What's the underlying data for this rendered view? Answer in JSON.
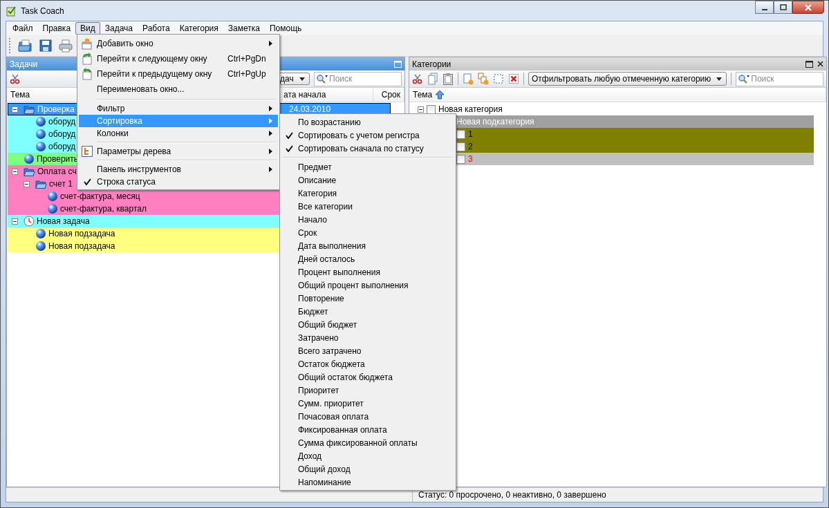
{
  "window": {
    "title": "Task Coach"
  },
  "menubar": [
    {
      "label": "Файл",
      "selected": false
    },
    {
      "label": "Правка",
      "selected": false
    },
    {
      "label": "Вид",
      "selected": true
    },
    {
      "label": "Задача",
      "selected": false
    },
    {
      "label": "Работа",
      "selected": false
    },
    {
      "label": "Категория",
      "selected": false
    },
    {
      "label": "Заметка",
      "selected": false
    },
    {
      "label": "Помощь",
      "selected": false
    }
  ],
  "view_menu": [
    {
      "kind": "item",
      "label": "Добавить окно",
      "submenu": true,
      "selected": false,
      "checked": false
    },
    {
      "kind": "item",
      "label": "Перейти к следующему окну",
      "shortcut": "Ctrl+PgDn",
      "submenu": false,
      "selected": false,
      "checked": false
    },
    {
      "kind": "item",
      "label": "Перейти к предыдущему окну",
      "shortcut": "Ctrl+PgUp",
      "submenu": false,
      "selected": false,
      "checked": false
    },
    {
      "kind": "item",
      "label": "Переименовать окно...",
      "submenu": false,
      "selected": false,
      "checked": false
    },
    {
      "kind": "separator"
    },
    {
      "kind": "item",
      "label": "Фильтр",
      "submenu": true,
      "selected": false,
      "checked": false
    },
    {
      "kind": "item",
      "label": "Сортировка",
      "submenu": true,
      "selected": true,
      "checked": false
    },
    {
      "kind": "item",
      "label": "Колонки",
      "submenu": true,
      "selected": false,
      "checked": false
    },
    {
      "kind": "separator"
    },
    {
      "kind": "item",
      "label": "Параметры дерева",
      "submenu": true,
      "selected": false,
      "checked": false
    },
    {
      "kind": "separator"
    },
    {
      "kind": "item",
      "label": "Панель инструментов",
      "submenu": true,
      "selected": false,
      "checked": false
    },
    {
      "kind": "item",
      "label": "Строка статуса",
      "submenu": false,
      "selected": false,
      "checked": true
    }
  ],
  "sort_menu": [
    {
      "kind": "item",
      "label": "По возрастанию",
      "checked": false
    },
    {
      "kind": "item",
      "label": "Сортировать с учетом регистра",
      "checked": true
    },
    {
      "kind": "item",
      "label": "Сортировать сначала по статусу",
      "checked": true
    },
    {
      "kind": "separator"
    },
    {
      "kind": "item",
      "label": "Предмет",
      "checked": false
    },
    {
      "kind": "item",
      "label": "Описание",
      "checked": false
    },
    {
      "kind": "item",
      "label": "Категория",
      "checked": false
    },
    {
      "kind": "item",
      "label": "Все категории",
      "checked": false
    },
    {
      "kind": "item",
      "label": "Начало",
      "checked": false
    },
    {
      "kind": "item",
      "label": "Срок",
      "checked": false
    },
    {
      "kind": "item",
      "label": "Дата выполнения",
      "checked": false
    },
    {
      "kind": "item",
      "label": "Дней осталось",
      "checked": false
    },
    {
      "kind": "item",
      "label": "Процент выполнения",
      "checked": false
    },
    {
      "kind": "item",
      "label": "Общий процент выполнения",
      "checked": false
    },
    {
      "kind": "item",
      "label": "Повторение",
      "checked": false
    },
    {
      "kind": "item",
      "label": "Бюджет",
      "checked": false
    },
    {
      "kind": "item",
      "label": "Общий бюджет",
      "checked": false
    },
    {
      "kind": "item",
      "label": "Затрачено",
      "checked": false
    },
    {
      "kind": "item",
      "label": "Всего затрачено",
      "checked": false
    },
    {
      "kind": "item",
      "label": "Остаток бюджета",
      "checked": false
    },
    {
      "kind": "item",
      "label": "Общий остаток бюджета",
      "checked": false
    },
    {
      "kind": "item",
      "label": "Приоритет",
      "checked": false
    },
    {
      "kind": "item",
      "label": "Сумм. приоритет",
      "checked": false
    },
    {
      "kind": "item",
      "label": "Почасовая оплата",
      "checked": false
    },
    {
      "kind": "item",
      "label": "Фиксированная оплата",
      "checked": false
    },
    {
      "kind": "item",
      "label": "Сумма фиксированной оплаты",
      "checked": false
    },
    {
      "kind": "item",
      "label": "Доход",
      "checked": false
    },
    {
      "kind": "item",
      "label": "Общий доход",
      "checked": false
    },
    {
      "kind": "item",
      "label": "Напоминание",
      "checked": false
    }
  ],
  "tasks_pane": {
    "title": "Задачи",
    "filter_combo": {
      "value": "дач"
    },
    "search": {
      "placeholder": "Поиск"
    },
    "columns": [
      "Тема",
      "ата начала",
      "Срок"
    ],
    "tasks": [
      {
        "label": "Проверка",
        "kind": "folder",
        "selected": true,
        "expanded": true,
        "start_date": "24.03.2010",
        "children": [
          {
            "label": "оборуд",
            "kind": "ball",
            "color": "#80ffff",
            "selected": false
          },
          {
            "label": "оборуд",
            "kind": "ball",
            "color": "#80ffff",
            "selected": false
          },
          {
            "label": "оборуд",
            "kind": "ball",
            "color": "#80ffff",
            "selected": false
          }
        ]
      },
      {
        "label": "Проверить",
        "kind": "ball",
        "color": "#80ff80",
        "selected": false
      },
      {
        "label": "Оплата сч",
        "kind": "folder",
        "color": "#ff80c0",
        "selected": false,
        "expanded": true,
        "children": [
          {
            "label": "счет 1",
            "kind": "folder",
            "color": "#ff80c0",
            "selected": false,
            "expanded": true,
            "children": [
              {
                "label": "счет-фактура, месяц",
                "kind": "ball",
                "color": "#ff80c0",
                "selected": false
              },
              {
                "label": "счет-фактура, квартал",
                "kind": "ball",
                "color": "#ff80c0",
                "selected": false
              }
            ]
          }
        ]
      },
      {
        "label": "Новая задача",
        "kind": "clock",
        "color": "#80ffff",
        "selected": false,
        "expanded": true,
        "children": [
          {
            "label": "Новая подзадача",
            "kind": "ball",
            "color": "#ffff80",
            "selected": false
          },
          {
            "label": "Новая подзадача",
            "kind": "ball",
            "color": "#ffff80",
            "selected": false
          }
        ]
      }
    ]
  },
  "categories_pane": {
    "title": "Категории",
    "filter_combo": {
      "value": "Отфильтровать любую отмеченную категорию"
    },
    "search": {
      "placeholder": "Поиск"
    },
    "columns": [
      "Тема"
    ],
    "categories": [
      {
        "label": "Новая категория",
        "checked": false,
        "expanded": true,
        "children": [
          {
            "label": "Новая подкатегория",
            "color": "#a0a0a0",
            "label_style": {
              "color": "#ffffff"
            },
            "children": [
              {
                "label": "1",
                "checked": false,
                "color": "#808000",
                "label_style": {
                  "color": "#000000"
                }
              },
              {
                "label": "2",
                "checked": false,
                "color": "#808000",
                "label_style": {
                  "color": "#000000"
                }
              },
              {
                "label": "3",
                "checked": false,
                "color": "#c0c0c0",
                "label_style": {
                  "color": "#ff0000"
                }
              }
            ]
          }
        ]
      }
    ]
  },
  "status_bar": {
    "text": "Статус: 0 просрочено, 0 неактивно, 0 завершено"
  }
}
